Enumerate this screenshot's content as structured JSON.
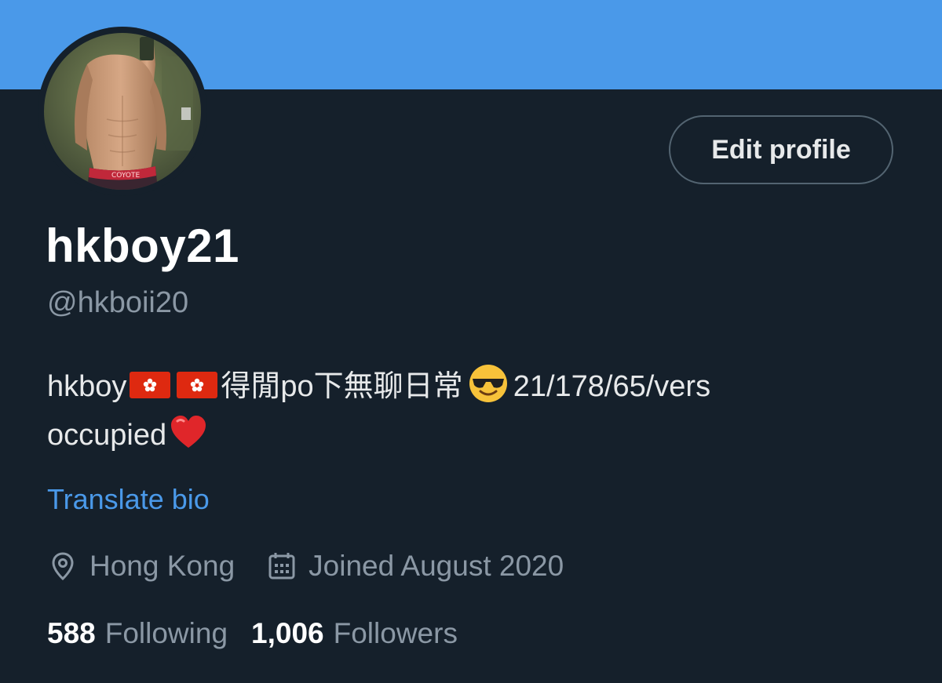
{
  "colors": {
    "banner": "#4a99e9",
    "background": "#15202b",
    "accent": "#4a99e9",
    "secondary_text": "#8b98a5"
  },
  "profile": {
    "display_name": "hkboy21",
    "handle": "@hkboii20",
    "avatar_icon": "profile-photo",
    "bio": {
      "line1_prefix": "hkboy",
      "line1_text": "得閒po下無聊日常",
      "line1_suffix": "21/178/65/vers",
      "line2_text": "occupied",
      "flag_icon": "hong-kong-flag-emoji",
      "sunglasses_icon": "smiling-face-with-sunglasses-emoji",
      "heart_icon": "red-heart-emoji"
    },
    "translate_label": "Translate bio",
    "location": "Hong Kong",
    "location_icon": "location-pin-icon",
    "joined": "Joined August 2020",
    "joined_icon": "calendar-icon"
  },
  "actions": {
    "edit_profile_label": "Edit profile"
  },
  "stats": {
    "following_count": "588",
    "following_label": "Following",
    "followers_count": "1,006",
    "followers_label": "Followers"
  }
}
